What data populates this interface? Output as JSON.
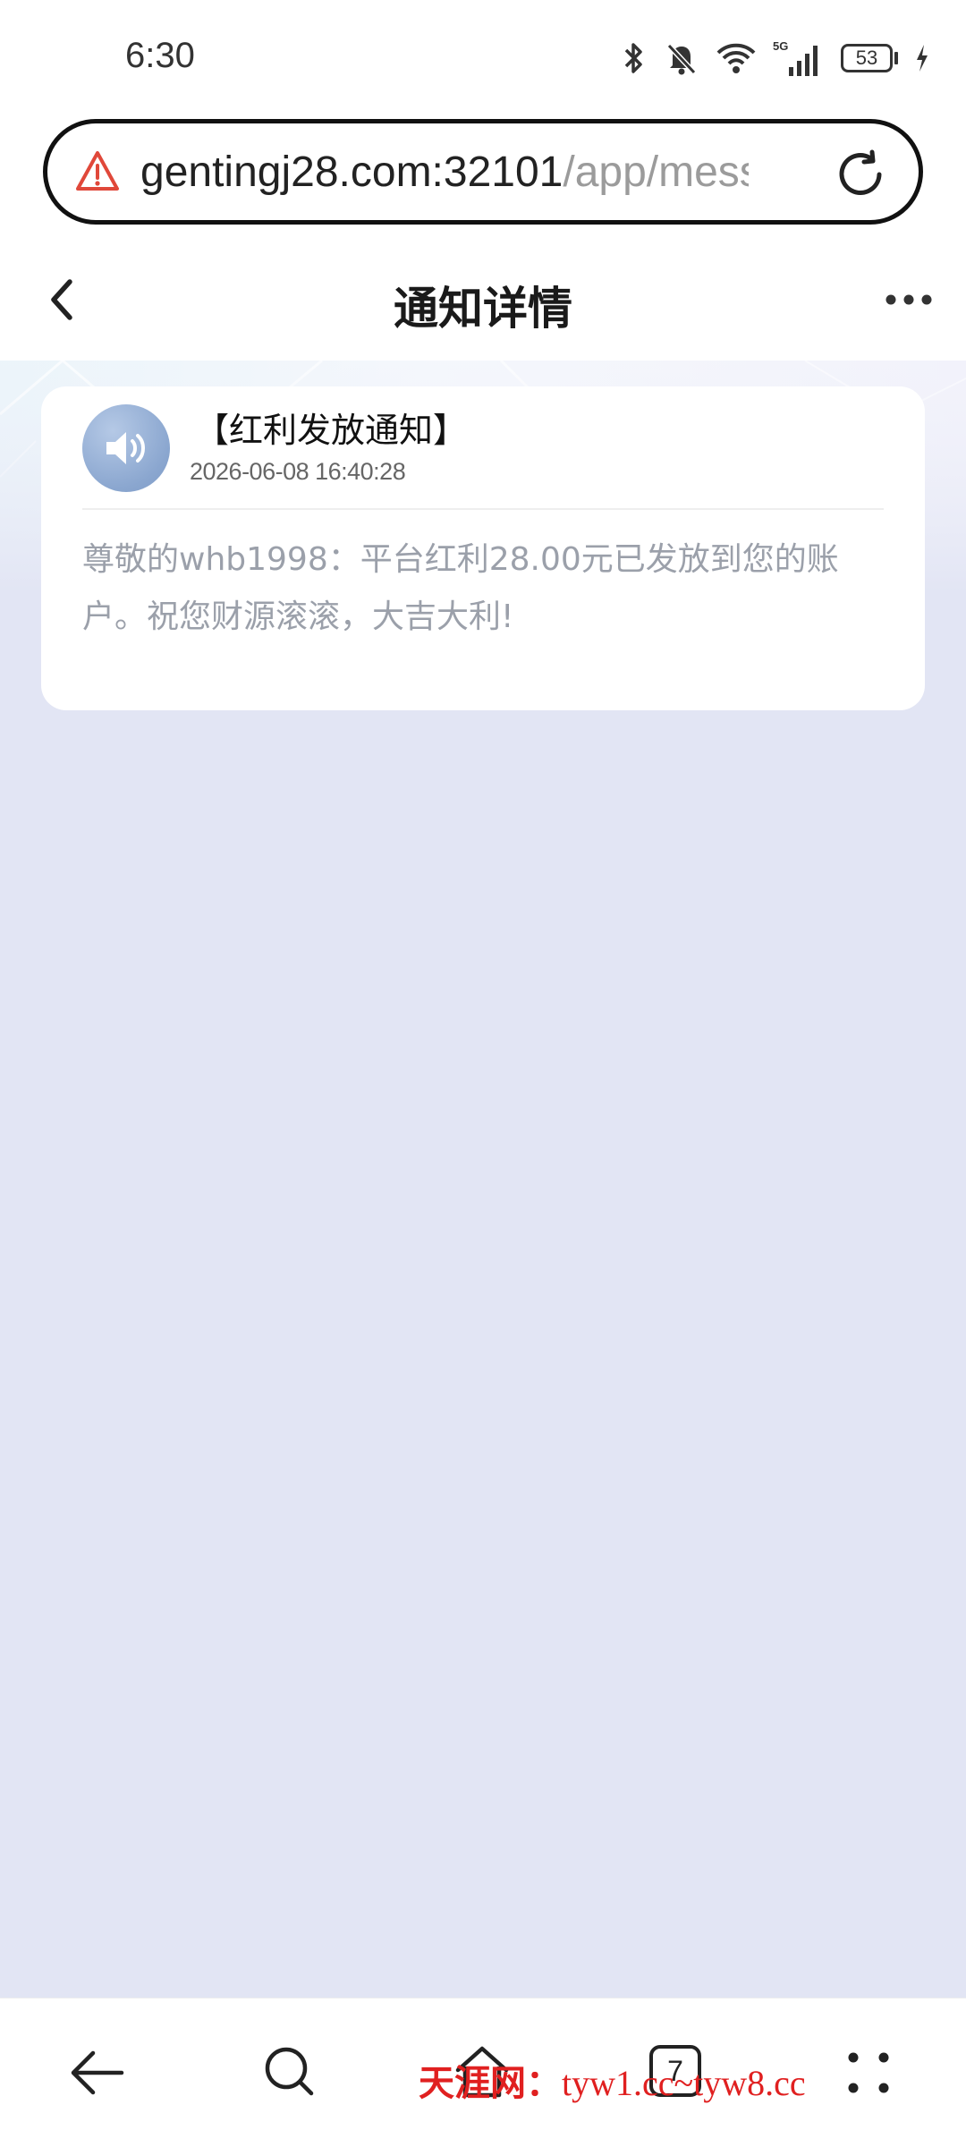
{
  "status_bar": {
    "time": "6:30",
    "battery": "53",
    "network": "5G"
  },
  "browser": {
    "url_host": "gentingj28.com:32101",
    "url_path": "/app/messa",
    "security_icon": "warning-triangle-icon",
    "reload_icon": "reload-icon"
  },
  "header": {
    "title": "通知详情",
    "back_icon": "chevron-left-icon",
    "more_icon": "more-dots-icon"
  },
  "notification": {
    "title": "【红利发放通知】",
    "time": "2026-06-08 16:40:28",
    "body": "尊敬的whb1998：平台红利28.00元已发放到您的账户。祝您财源滚滚，大吉大利!",
    "avatar_icon": "speaker-icon"
  },
  "bottom_nav": {
    "tab_count": "7",
    "items": [
      "back-arrow-icon",
      "search-icon",
      "home-icon",
      "tabs-icon",
      "menu-icon"
    ]
  },
  "watermark": {
    "site": "天涯网：",
    "urls": "tyw1.cc~tyw8.cc"
  },
  "colors": {
    "background": "#e2e5f4",
    "card": "#ffffff",
    "warning": "#e0483a",
    "watermark": "#e02020"
  }
}
